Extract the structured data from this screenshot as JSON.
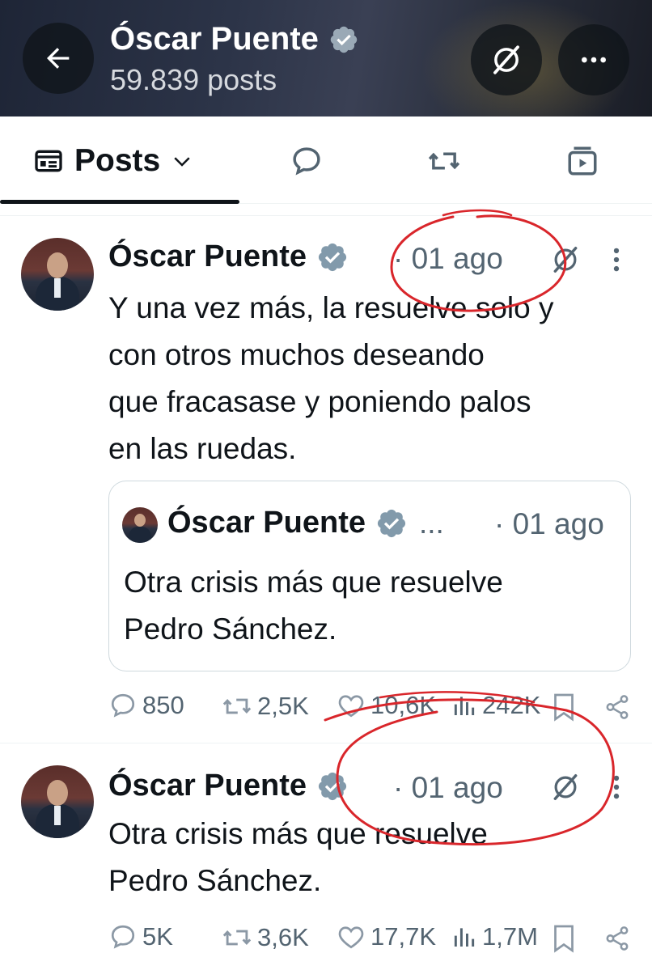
{
  "header": {
    "name": "Óscar Puente",
    "posts_count": "59.839 posts",
    "back_icon": "arrow-left-icon",
    "grok_icon": "grok-icon",
    "more_icon": "more-horizontal-icon"
  },
  "tabs": {
    "posts_label": "Posts",
    "items": [
      "posts",
      "replies",
      "reposts",
      "media"
    ]
  },
  "posts": [
    {
      "author": "Óscar Puente",
      "time": "· 01 ago",
      "text_lines": [
        "Y una vez más, la resuelve solo y",
        "con otros muchos deseando",
        "que fracasase y poniendo palos",
        "en las ruedas."
      ],
      "quote": {
        "author": "Óscar Puente",
        "ellipsis": "...",
        "time": "· 01 ago",
        "text_lines": [
          "Otra crisis más que resuelve",
          "Pedro Sánchez."
        ]
      },
      "stats": {
        "replies": "850",
        "reposts": "2,5K",
        "likes": "10,6K",
        "views": "242K"
      }
    },
    {
      "author": "Óscar Puente",
      "time": "· 01 ago",
      "text_lines": [
        "Otra crisis más que resuelve",
        "Pedro Sánchez."
      ],
      "stats": {
        "replies": "5K",
        "reposts": "3,6K",
        "likes": "17,7K",
        "views": "1,7M"
      }
    }
  ],
  "colors": {
    "text": "#0f1419",
    "secondary": "#536471",
    "verified_badge": "#829aab",
    "annotation": "#d9262b"
  }
}
